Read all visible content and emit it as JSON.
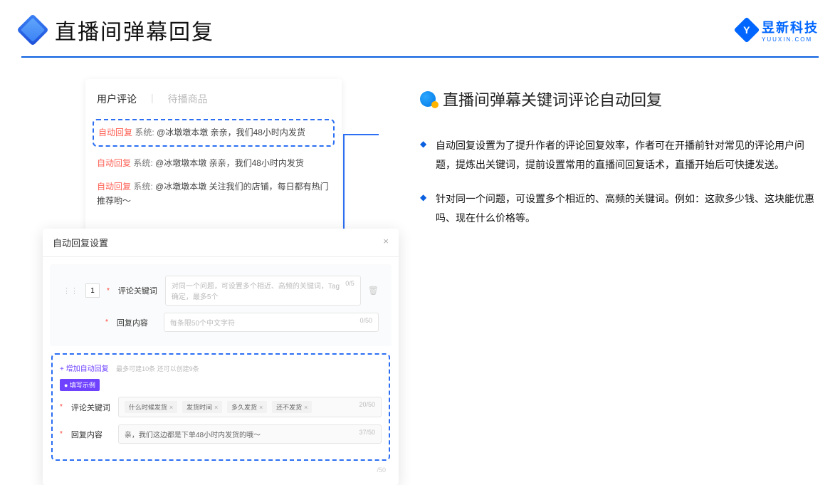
{
  "header": {
    "title": "直播间弹幕回复",
    "brand_name": "昱新科技",
    "brand_sub": "YUUXIN.COM",
    "brand_letter": "Y"
  },
  "comments": {
    "tab_active": "用户评论",
    "tab_inactive": "待播商品",
    "badge_auto": "自动回复",
    "badge_sys": "系统:",
    "row1": "@冰墩墩本墩 亲亲，我们48小时内发货",
    "row2": "@冰墩墩本墩 亲亲，我们48小时内发货",
    "row3": "@冰墩墩本墩 关注我们的店铺，每日都有热门推荐哟～"
  },
  "settings": {
    "title": "自动回复设置",
    "close": "×",
    "index": "1",
    "label_keyword": "评论关键词",
    "placeholder_keyword": "对同一个问题，可设置多个相近、高频的关键词，Tag确定，最多5个",
    "counter_keyword": "0/5",
    "label_content": "回复内容",
    "placeholder_content": "每条限50个中文字符",
    "counter_content": "0/50",
    "add_link": "+ 增加自动回复",
    "add_note": "最多可建10条 还可以创建9条",
    "example_badge": "● 填写示例",
    "ex_label_kw": "评论关键词",
    "ex_tags": [
      "什么时候发货",
      "发货时间",
      "多久发货",
      "还不发货"
    ],
    "ex_kw_counter": "20/50",
    "ex_label_ct": "回复内容",
    "ex_content": "亲，我们这边都是下单48小时内发货的哦～",
    "ex_ct_counter": "37/50",
    "outer_counter": "/50"
  },
  "right": {
    "title": "直播间弹幕关键词评论自动回复",
    "bullet1": "自动回复设置为了提升作者的评论回复效率，作者可在开播前针对常见的评论用户问题，提炼出关键词，提前设置常用的直播间回复话术，直播开始后可快捷发送。",
    "bullet2": "针对同一个问题，可设置多个相近的、高频的关键词。例如：这款多少钱、这块能优惠吗、现在什么价格等。"
  }
}
